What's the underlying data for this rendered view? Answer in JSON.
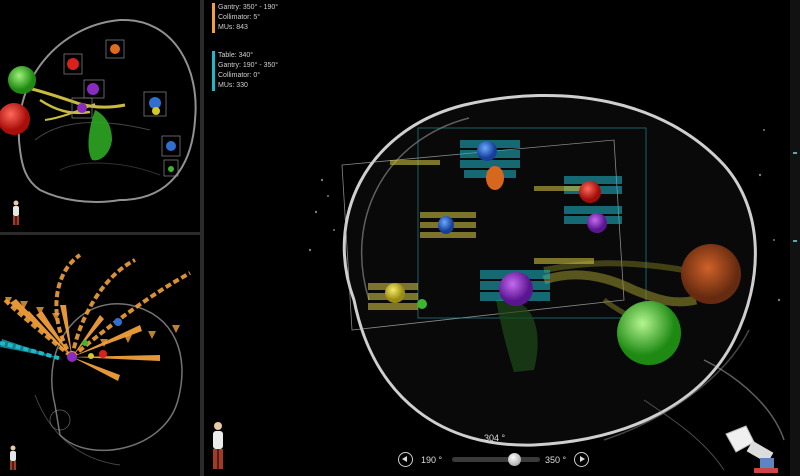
{
  "beams": [
    {
      "color": "#f2a03a",
      "lines": [
        "Gantry: 350° - 190°",
        "Collimator: 5°",
        "MUs: 843"
      ]
    },
    {
      "color": "#1fb8c8",
      "lines": [
        "Table: 340°",
        "Gantry: 190° - 350°",
        "Collimator: 0°",
        "MUs: 330"
      ]
    }
  ],
  "arc_control": {
    "current_label": "304 °",
    "min_label": "190 °",
    "max_label": "350 °",
    "min": 190,
    "max": 350,
    "value": 304
  },
  "icons": {
    "patient_orientation": "patient-figure-icon",
    "linac": "linac-gantry-icon",
    "prev": "previous-arrow-icon",
    "next": "next-arrow-icon"
  },
  "colors": {
    "arc_orange": "#f2a03a",
    "arc_cyan": "#1fb8c8",
    "target_red": "#d8201c",
    "target_purple": "#8a2bbf",
    "target_blue": "#2f6fd0",
    "target_yellow": "#d6c82a",
    "target_green": "#3fb52f",
    "target_orange": "#e06a1e",
    "skull": "#d9d9d9"
  }
}
